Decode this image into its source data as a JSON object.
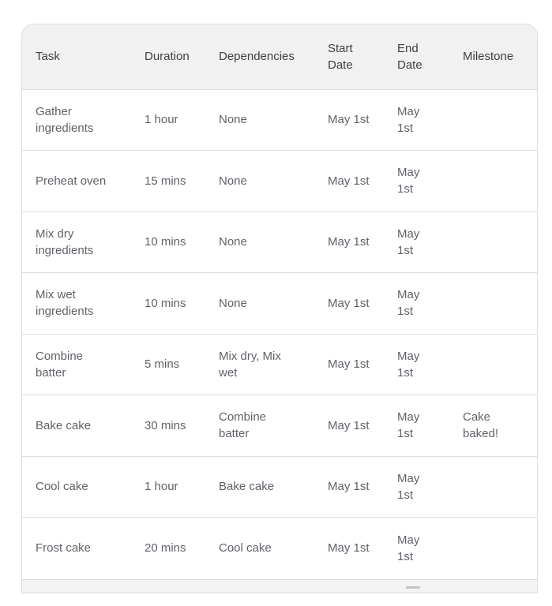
{
  "table": {
    "headers": [
      "Task",
      "Duration",
      "Dependencies",
      "Start Date",
      "End Date",
      "Milestone"
    ],
    "rows": [
      [
        "Gather ingredients",
        "1 hour",
        "None",
        "May 1st",
        "May 1st",
        ""
      ],
      [
        "Preheat oven",
        "15 mins",
        "None",
        "May 1st",
        "May 1st",
        ""
      ],
      [
        "Mix dry ingredients",
        "10 mins",
        "None",
        "May 1st",
        "May 1st",
        ""
      ],
      [
        "Mix wet ingredients",
        "10 mins",
        "None",
        "May 1st",
        "May 1st",
        ""
      ],
      [
        "Combine batter",
        "5 mins",
        "Mix dry, Mix wet",
        "May 1st",
        "May 1st",
        ""
      ],
      [
        "Bake cake",
        "30 mins",
        "Combine batter",
        "May 1st",
        "May 1st",
        "Cake baked!"
      ],
      [
        "Cool cake",
        "1 hour",
        "Bake cake",
        "May 1st",
        "May 1st",
        ""
      ],
      [
        "Frost cake",
        "20 mins",
        "Cool cake",
        "May 1st",
        "May 1st",
        ""
      ]
    ]
  }
}
